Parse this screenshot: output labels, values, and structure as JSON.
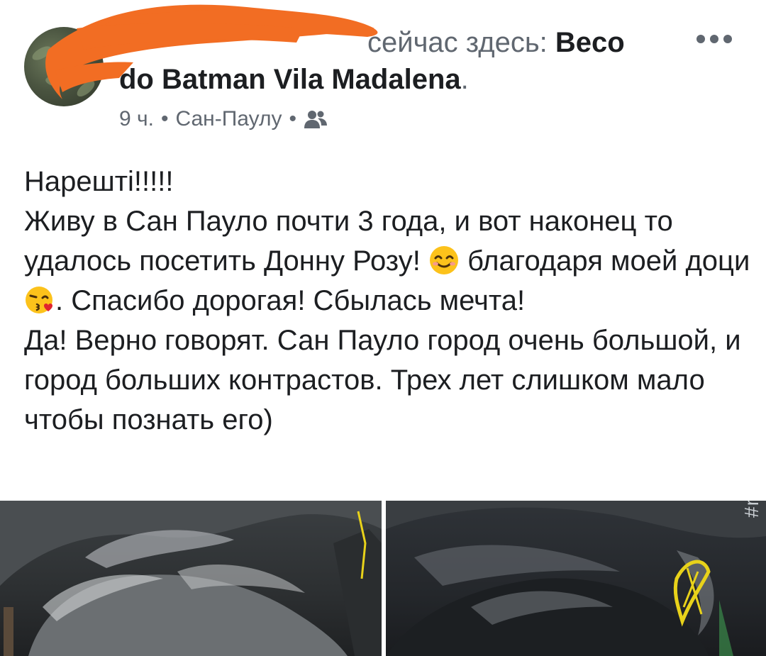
{
  "header": {
    "status_prefix": "сейчас здесь: ",
    "place_line1": "Beco",
    "place_line2": "do Batman Vila Madalena",
    "place_end": ".",
    "time": "9 ч.",
    "location": "Сан-Паулу",
    "separator": "•",
    "privacy_icon": "friends-icon",
    "more_icon": "more-dots-icon",
    "redaction_color": "#f26d23"
  },
  "post": {
    "paragraphs": [
      "Нарешті!!!!!",
      "Живу в Сан Пауло почти 3 года, и вот наконец то удалось посетить Донну Розу!",
      "благодаря моей доци",
      ". Спасибо дорогая! Сбылась мечта!",
      "Да! Верно говорят. Сан Пауло город очень большой, и город больших контрастов. Трех лет слишком мало чтобы познать его)"
    ],
    "emoji_1": "smiling-face-icon",
    "emoji_2": "kissing-face-heart-icon"
  },
  "photos": {
    "hashtag": "#myhoodisz"
  }
}
